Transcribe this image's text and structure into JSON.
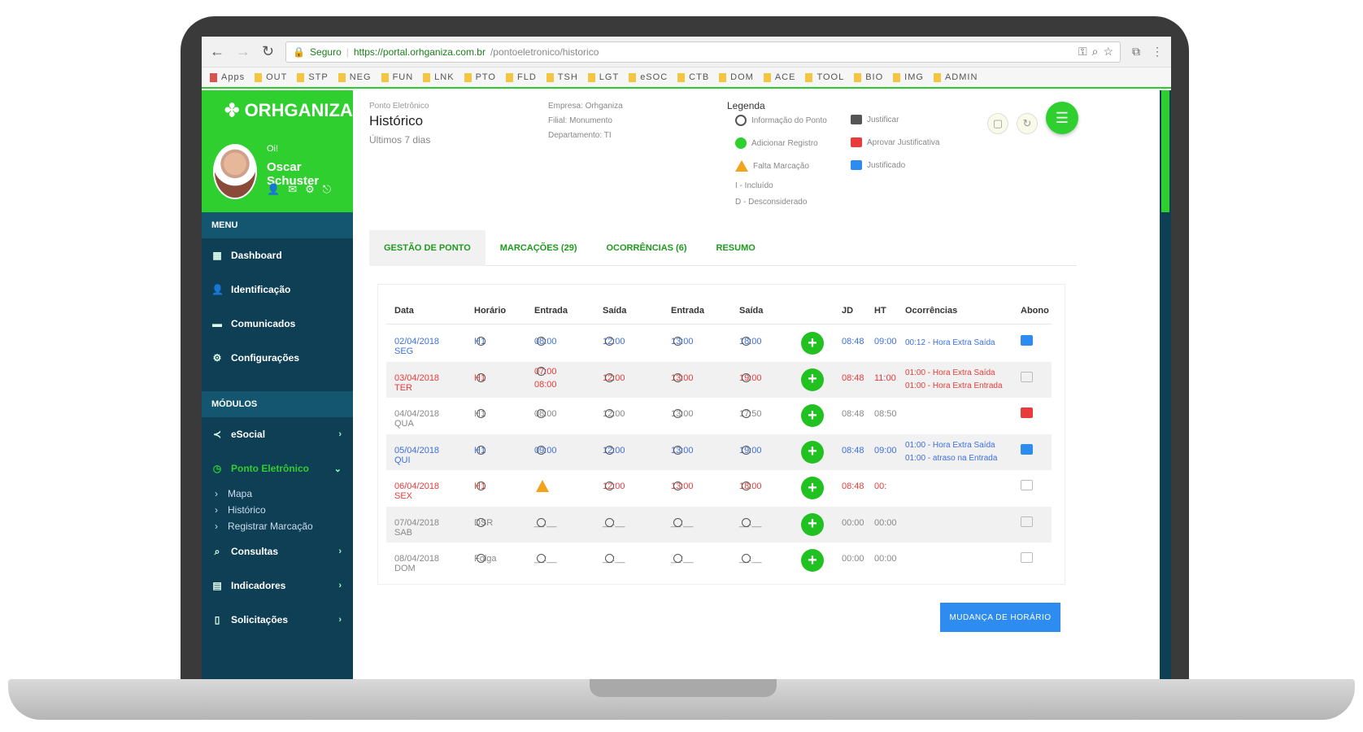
{
  "browser": {
    "secure_label": "Seguro",
    "url": "https://portal.orhganiza.com.br",
    "path": "/pontoeletronico/historico",
    "bookmarks": [
      "Apps",
      "OUT",
      "STP",
      "NEG",
      "FUN",
      "LNK",
      "PTO",
      "FLD",
      "TSH",
      "LGT",
      "eSOC",
      "CTB",
      "DOM",
      "ACE",
      "TOOL",
      "BIO",
      "IMG",
      "ADMIN"
    ]
  },
  "sidebar": {
    "logo": "ORHGANIZA",
    "greeting": "Oi!",
    "user_name": "Oscar Schuster",
    "menu_heading": "MENU",
    "menu_items": [
      "Dashboard",
      "Identificação",
      "Comunicados",
      "Configurações"
    ],
    "modules_heading": "MÓDULOS",
    "modules": [
      {
        "label": "eSocial",
        "icon": "share-icon"
      },
      {
        "label": "Ponto Eletrônico",
        "icon": "clock-icon"
      }
    ],
    "sub_items": [
      "Mapa",
      "Histórico",
      "Registrar Marcação"
    ],
    "more_modules": [
      "Consultas",
      "Indicadores",
      "Solicitações"
    ]
  },
  "header": {
    "breadcrumb": "Ponto Eletrônico",
    "title": "Histórico",
    "subtitle": "Últimos 7 dias",
    "company": "Empresa: Orhganiza",
    "branch": "Filial: Monumento",
    "department": "Departamento: TI"
  },
  "legend": {
    "title": "Legenda",
    "items": [
      {
        "label": "Informação do Ponto",
        "icon": "clock"
      },
      {
        "label": "Adicionar Registro",
        "icon": "green-plus"
      },
      {
        "label": "Falta Marcação",
        "icon": "warning"
      },
      {
        "label": "I - Incluído",
        "icon": ""
      },
      {
        "label": "D - Desconsiderado",
        "icon": ""
      },
      {
        "label": "Justificar",
        "icon": "chat-gray"
      },
      {
        "label": "Aprovar Justificativa",
        "icon": "chat-red"
      },
      {
        "label": "Justificado",
        "icon": "chat-blue"
      }
    ]
  },
  "tabs": [
    "GESTÃO DE PONTO",
    "MARCAÇÕES (29)",
    "OCORRÊNCIAS (6)",
    "RESUMO"
  ],
  "table": {
    "headers": [
      "Data",
      "Horário",
      "Entrada",
      "Saída",
      "Entrada",
      "Saída",
      "",
      "JD",
      "HT",
      "Ocorrências",
      "Abono"
    ],
    "rows": [
      {
        "date": "02/04/2018 SEG",
        "horario": "H1",
        "e1": "08:00",
        "s1": "12:00",
        "e2": "13:00",
        "s2": "18:00",
        "jd": "08:48",
        "ht": "09:00",
        "occ1": "00:12 - Hora Extra Saída",
        "occ2": "",
        "color": "#3d6fe0",
        "abono": "chat-blue",
        "warn": false
      },
      {
        "date": "03/04/2018 TER",
        "horario": "H1",
        "e1": "07:00",
        "e1b": "08:00",
        "s1": "12:00",
        "e2": "13:00",
        "s2": "19:00",
        "jd": "08:48",
        "ht": "11:00",
        "occ1": "01:00 - Hora Extra Saída",
        "occ2": "01:00 - Hora Extra Entrada",
        "color": "#e83b3b",
        "abono": "chat-gray",
        "warn": false
      },
      {
        "date": "04/04/2018 QUA",
        "horario": "H1",
        "e1": "08:00",
        "s1": "12:00",
        "e2": "13:00",
        "s2": "17:50",
        "jd": "08:48",
        "ht": "08:50",
        "occ1": "",
        "occ2": "",
        "color": "#888888",
        "abono": "chat-red",
        "warn": false
      },
      {
        "date": "05/04/2018 QUI",
        "horario": "H1",
        "e1": "09:00",
        "s1": "12:00",
        "e2": "13:00",
        "s2": "19:00",
        "jd": "08:48",
        "ht": "09:00",
        "occ1": "01:00 - Hora Extra Saída",
        "occ2": "01:00 - atraso na Entrada",
        "color": "#3d6fe0",
        "abono": "chat-blue",
        "warn": false
      },
      {
        "date": "06/04/2018 SEX",
        "horario": "H1",
        "e1": "",
        "s1": "12:00",
        "e2": "13:00",
        "s2": "18:00",
        "jd": "08:48",
        "ht": "00:",
        "occ1": "",
        "occ2": "",
        "color": "#e83b3b",
        "abono": "chat-gray",
        "warn": true
      },
      {
        "date": "07/04/2018 SAB",
        "horario": "DSR",
        "e1": "__:__",
        "s1": "__:__",
        "e2": "__:__",
        "s2": "__:__",
        "jd": "00:00",
        "ht": "00:00",
        "occ1": "",
        "occ2": "",
        "color": "#888888",
        "abono": "chat-gray",
        "warn": false
      },
      {
        "date": "08/04/2018 DOM",
        "horario": "Folga",
        "e1": "__:__",
        "s1": "__:__",
        "e2": "__:__",
        "s2": "__:__",
        "jd": "00:00",
        "ht": "00:00",
        "occ1": "",
        "occ2": "",
        "color": "#888888",
        "abono": "chat-gray",
        "warn": false
      }
    ]
  },
  "actions": {
    "change_schedule": "MUDANÇA DE HORÁRIO"
  },
  "colors": {
    "brand_green": "#2fcf2f",
    "sidebar_bg": "#0e3f54",
    "accent_blue": "#2e8cf0",
    "alert_red": "#e83b3b"
  }
}
